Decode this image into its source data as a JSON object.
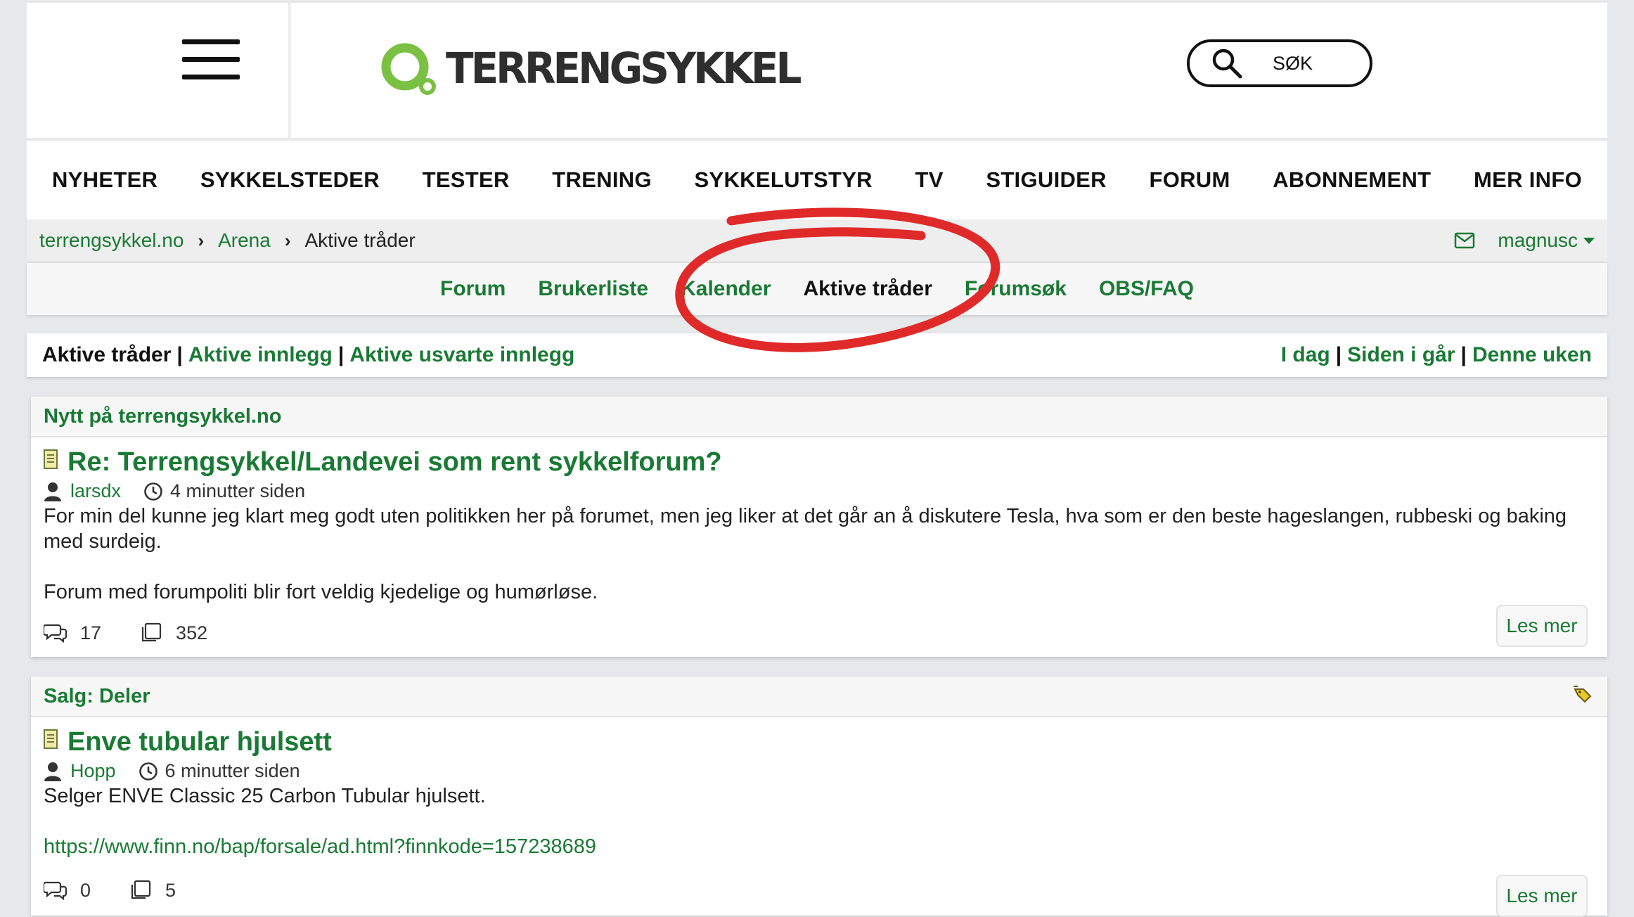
{
  "header": {
    "logo_text": "TERRENGSYKKEL",
    "search_label": "SØK"
  },
  "mainnav": [
    "NYHETER",
    "SYKKELSTEDER",
    "TESTER",
    "TRENING",
    "SYKKELUTSTYR",
    "TV",
    "STIGUIDER",
    "FORUM",
    "ABONNEMENT",
    "MER INFO"
  ],
  "breadcrumb": {
    "items": [
      "terrengsykkel.no",
      "Arena"
    ],
    "current": "Aktive tråder",
    "username": "magnusc"
  },
  "subnav": {
    "items": [
      "Forum",
      "Brukerliste",
      "Kalender",
      "Aktive tråder",
      "Forumsøk",
      "OBS/FAQ"
    ],
    "active_index": 3
  },
  "filter": {
    "left": [
      "Aktive tråder",
      "Aktive innlegg",
      "Aktive usvarte innlegg"
    ],
    "right": [
      "I dag",
      "Siden i går",
      "Denne uken"
    ],
    "separator": "|"
  },
  "posts": [
    {
      "category": "Nytt på terrengsykkel.no",
      "title": "Re: Terrengsykkel/Landevei som rent sykkelforum?",
      "author": "larsdx",
      "time": "4 minutter siden",
      "paragraphs": [
        "For min del kunne jeg klart meg godt uten politikken her på forumet, men jeg liker at det går an å diskutere Tesla, hva som er den beste hageslangen, rubbeski og baking med surdeig.",
        "Forum med forumpoliti blir fort veldig kjedelige og humørløse."
      ],
      "replies": "17",
      "views": "352",
      "read_more": "Les mer"
    },
    {
      "category": "Salg: Deler",
      "title": "Enve tubular hjulsett",
      "author": "Hopp",
      "time": "6 minutter siden",
      "paragraphs": [
        "Selger ENVE Classic 25 Carbon Tubular hjulsett."
      ],
      "link": "https://www.finn.no/bap/forsale/ad.html?finnkode=157238689",
      "replies": "0",
      "views": "5",
      "read_more": "Les mer"
    }
  ],
  "colors": {
    "accent_green": "#1a7a35",
    "annotation_red": "#e02a2a",
    "logo_green": "#7ac043"
  }
}
